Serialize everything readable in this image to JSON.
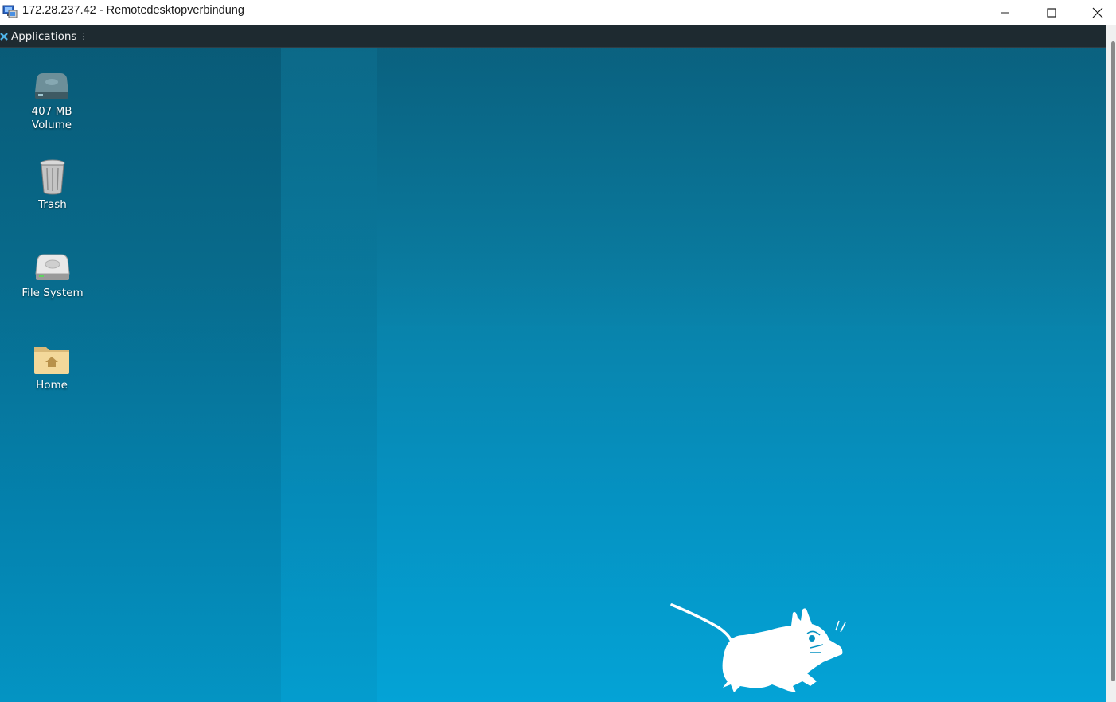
{
  "window": {
    "title": "172.28.237.42 - Remotedesktopverbindung",
    "controls": [
      "minimize",
      "maximize",
      "close"
    ]
  },
  "panel": {
    "applications_label": "Applications",
    "grip": "⋮"
  },
  "desktop": {
    "icons": [
      {
        "label": "407 MB\nVolume",
        "icon": "drive-icon"
      },
      {
        "label": "Trash",
        "icon": "trash-icon"
      },
      {
        "label": "File System",
        "icon": "harddisk-icon"
      },
      {
        "label": "Home",
        "icon": "home-folder-icon"
      }
    ]
  },
  "colors": {
    "panel": "#1e2a30",
    "desktop_top": "#0d6f8f",
    "desktop_bottom": "#04a3d6"
  }
}
